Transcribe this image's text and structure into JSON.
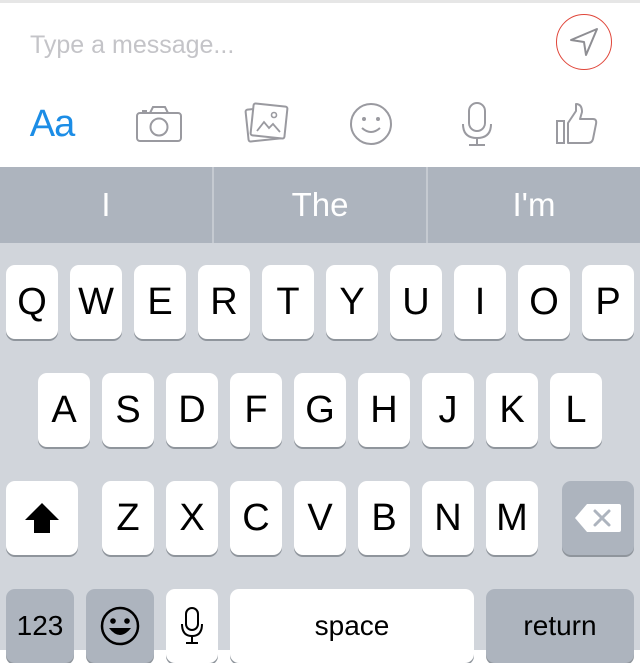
{
  "composer": {
    "placeholder": "Type a message...",
    "format_label": "Aa",
    "accent_color": "#1c8de6",
    "send_ring_color": "#e0463a"
  },
  "suggestions": [
    "I",
    "The",
    "I'm"
  ],
  "keyboard": {
    "row1": [
      "Q",
      "W",
      "E",
      "R",
      "T",
      "Y",
      "U",
      "I",
      "O",
      "P"
    ],
    "row2": [
      "A",
      "S",
      "D",
      "F",
      "G",
      "H",
      "J",
      "K",
      "L"
    ],
    "row3": [
      "Z",
      "X",
      "C",
      "V",
      "B",
      "N",
      "M"
    ],
    "numbers_label": "123",
    "space_label": "space",
    "return_label": "return"
  },
  "icons": [
    "send-arrow-icon",
    "camera-icon",
    "photos-icon",
    "smiley-icon",
    "microphone-icon",
    "thumbs-up-icon",
    "shift-icon",
    "backspace-icon",
    "emoji-icon",
    "dictation-mic-icon"
  ]
}
